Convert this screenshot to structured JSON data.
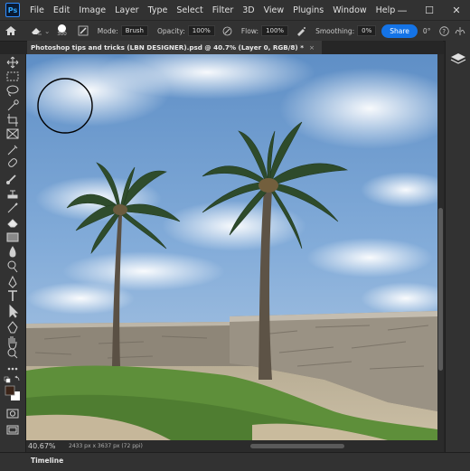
{
  "app": {
    "logo_text": "Ps"
  },
  "menu": [
    "File",
    "Edit",
    "Image",
    "Layer",
    "Type",
    "Select",
    "Filter",
    "3D",
    "View",
    "Plugins",
    "Window",
    "Help"
  ],
  "window_controls": {
    "minimize": "—",
    "maximize": "☐",
    "close": "✕"
  },
  "options": {
    "brush_size": "300",
    "mode_label": "Mode:",
    "mode_value": "Brush",
    "opacity_label": "Opacity:",
    "opacity_value": "100%",
    "flow_label": "Flow:",
    "flow_value": "100%",
    "smoothing_label": "Smoothing:",
    "smoothing_value": "0%",
    "angle_value": "0°",
    "share_label": "Share"
  },
  "document": {
    "tab_title": "Photoshop tips and tricks (LBN  DESIGNER).psd @ 40.7% (Layer 0, RGB/8) *",
    "close_glyph": "×"
  },
  "status": {
    "zoom": "40.67%",
    "doc_size": "2433 px x 3637 px (72 ppi)"
  },
  "timeline": {
    "label": "Timeline"
  },
  "colors": {
    "foreground": "#3b2418",
    "background": "#ffffff",
    "accent": "#1473e6"
  },
  "icons": [
    "home-icon",
    "eraser-icon",
    "brush-preset-icon",
    "brush-settings-icon",
    "airbrush-icon",
    "pressure-icon",
    "symmetry-icon",
    "help-icon",
    "workspace-icon"
  ]
}
